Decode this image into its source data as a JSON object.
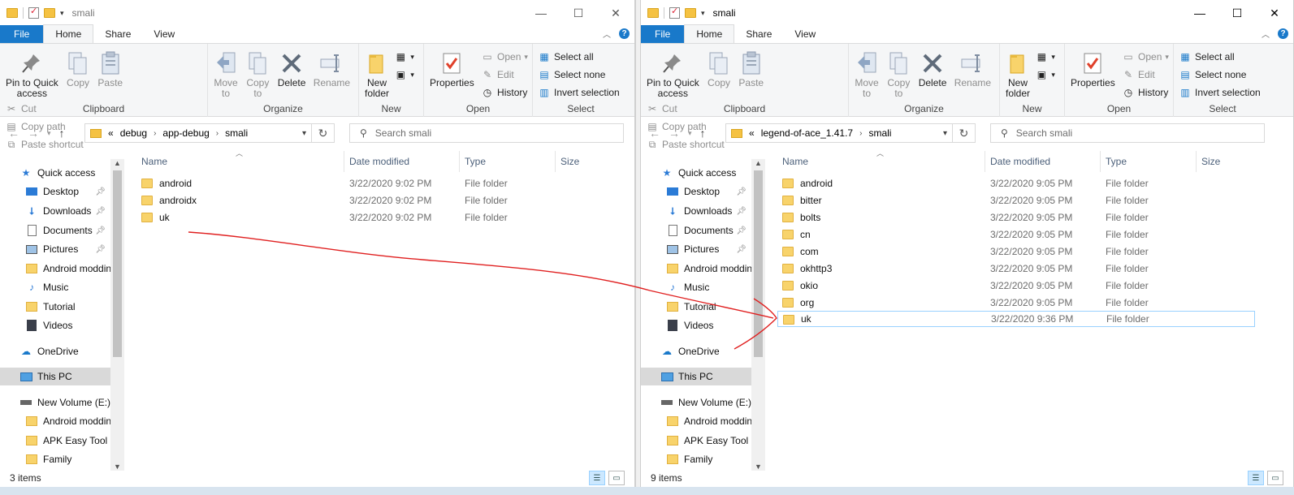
{
  "left": {
    "title": "smali",
    "tabs": [
      "File",
      "Home",
      "Share",
      "View"
    ],
    "ribbon": {
      "clipboard": {
        "pin": "Pin to Quick\naccess",
        "copy": "Copy",
        "paste": "Paste",
        "cut": "Cut",
        "copy_path": "Copy path",
        "paste_shortcut": "Paste shortcut",
        "label": "Clipboard"
      },
      "organize": {
        "move_to": "Move\nto",
        "copy_to": "Copy\nto",
        "delete": "Delete",
        "rename": "Rename",
        "label": "Organize"
      },
      "new": {
        "new_folder": "New\nfolder",
        "label": "New"
      },
      "open": {
        "properties": "Properties",
        "open": "Open",
        "edit": "Edit",
        "history": "History",
        "label": "Open"
      },
      "select": {
        "select_all": "Select all",
        "select_none": "Select none",
        "invert": "Invert selection",
        "label": "Select"
      }
    },
    "address": {
      "prefix": "«",
      "crumbs": [
        "debug",
        "app-debug",
        "smali"
      ]
    },
    "search_placeholder": "Search smali",
    "nav": [
      {
        "label": "Quick access",
        "icon": "star-icon"
      },
      {
        "label": "Desktop",
        "icon": "desktop-icon",
        "pin": true
      },
      {
        "label": "Downloads",
        "icon": "download-icon",
        "pin": true
      },
      {
        "label": "Documents",
        "icon": "document-icon",
        "pin": true
      },
      {
        "label": "Pictures",
        "icon": "picture-icon",
        "pin": true
      },
      {
        "label": "Android moddin",
        "icon": "folder-icon"
      },
      {
        "label": "Music",
        "icon": "music-icon"
      },
      {
        "label": "Tutorial",
        "icon": "folder-icon"
      },
      {
        "label": "Videos",
        "icon": "video-icon"
      },
      {
        "label": "OneDrive",
        "icon": "cloud-icon"
      },
      {
        "label": "This PC",
        "icon": "pc-icon",
        "selected": true
      },
      {
        "label": "New Volume (E:)",
        "icon": "drive-icon"
      },
      {
        "label": "Android moddin",
        "icon": "folder-icon"
      },
      {
        "label": "APK Easy Tool",
        "icon": "folder-icon"
      },
      {
        "label": "Family",
        "icon": "folder-icon"
      }
    ],
    "columns": [
      "Name",
      "Date modified",
      "Type",
      "Size"
    ],
    "files": [
      {
        "name": "android",
        "date": "3/22/2020 9:02 PM",
        "type": "File folder"
      },
      {
        "name": "androidx",
        "date": "3/22/2020 9:02 PM",
        "type": "File folder"
      },
      {
        "name": "uk",
        "date": "3/22/2020 9:02 PM",
        "type": "File folder"
      }
    ],
    "status": "3 items"
  },
  "right": {
    "title": "smali",
    "tabs": [
      "File",
      "Home",
      "Share",
      "View"
    ],
    "ribbon": {
      "clipboard": {
        "pin": "Pin to Quick\naccess",
        "copy": "Copy",
        "paste": "Paste",
        "cut": "Cut",
        "copy_path": "Copy path",
        "paste_shortcut": "Paste shortcut",
        "label": "Clipboard"
      },
      "organize": {
        "move_to": "Move\nto",
        "copy_to": "Copy\nto",
        "delete": "Delete",
        "rename": "Rename",
        "label": "Organize"
      },
      "new": {
        "new_folder": "New\nfolder",
        "label": "New"
      },
      "open": {
        "properties": "Properties",
        "open": "Open",
        "edit": "Edit",
        "history": "History",
        "label": "Open"
      },
      "select": {
        "select_all": "Select all",
        "select_none": "Select none",
        "invert": "Invert selection",
        "label": "Select"
      }
    },
    "address": {
      "prefix": "«",
      "crumbs": [
        "legend-of-ace_1.41.7",
        "smali"
      ]
    },
    "search_placeholder": "Search smali",
    "nav": [
      {
        "label": "Quick access",
        "icon": "star-icon"
      },
      {
        "label": "Desktop",
        "icon": "desktop-icon",
        "pin": true
      },
      {
        "label": "Downloads",
        "icon": "download-icon",
        "pin": true
      },
      {
        "label": "Documents",
        "icon": "document-icon",
        "pin": true
      },
      {
        "label": "Pictures",
        "icon": "picture-icon",
        "pin": true
      },
      {
        "label": "Android moddin",
        "icon": "folder-icon"
      },
      {
        "label": "Music",
        "icon": "music-icon"
      },
      {
        "label": "Tutorial",
        "icon": "folder-icon"
      },
      {
        "label": "Videos",
        "icon": "video-icon"
      },
      {
        "label": "OneDrive",
        "icon": "cloud-icon"
      },
      {
        "label": "This PC",
        "icon": "pc-icon",
        "selected": true
      },
      {
        "label": "New Volume (E:)",
        "icon": "drive-icon"
      },
      {
        "label": "Android moddin",
        "icon": "folder-icon"
      },
      {
        "label": "APK Easy Tool",
        "icon": "folder-icon"
      },
      {
        "label": "Family",
        "icon": "folder-icon"
      }
    ],
    "columns": [
      "Name",
      "Date modified",
      "Type",
      "Size"
    ],
    "files": [
      {
        "name": "android",
        "date": "3/22/2020 9:05 PM",
        "type": "File folder"
      },
      {
        "name": "bitter",
        "date": "3/22/2020 9:05 PM",
        "type": "File folder"
      },
      {
        "name": "bolts",
        "date": "3/22/2020 9:05 PM",
        "type": "File folder"
      },
      {
        "name": "cn",
        "date": "3/22/2020 9:05 PM",
        "type": "File folder"
      },
      {
        "name": "com",
        "date": "3/22/2020 9:05 PM",
        "type": "File folder"
      },
      {
        "name": "okhttp3",
        "date": "3/22/2020 9:05 PM",
        "type": "File folder"
      },
      {
        "name": "okio",
        "date": "3/22/2020 9:05 PM",
        "type": "File folder"
      },
      {
        "name": "org",
        "date": "3/22/2020 9:05 PM",
        "type": "File folder"
      },
      {
        "name": "uk",
        "date": "3/22/2020 9:36 PM",
        "type": "File folder",
        "selected": true
      }
    ],
    "status": "9 items"
  },
  "colors": {
    "accent": "#1979ca",
    "arrow": "#e02020",
    "folder": "#f8d36b"
  }
}
